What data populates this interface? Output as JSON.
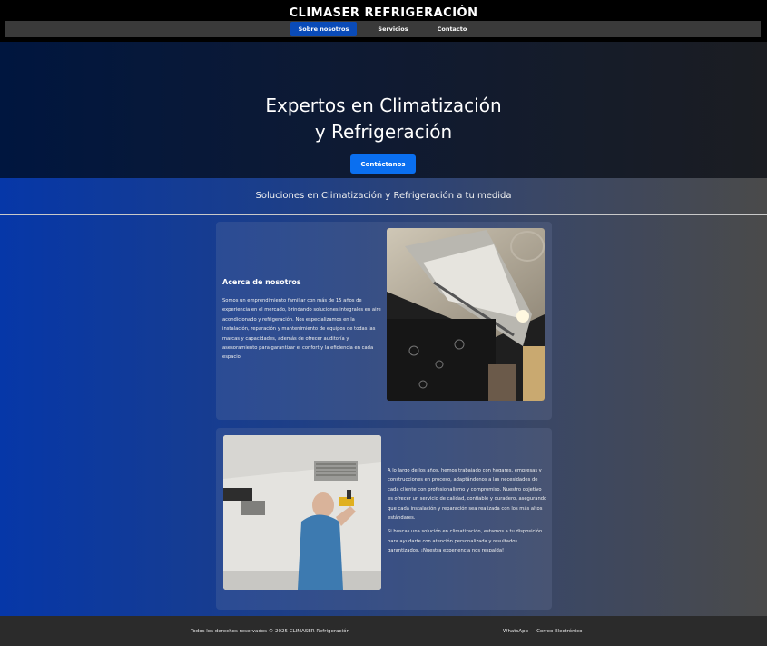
{
  "header": {
    "brand": "CLIMASER REFRIGERACIÓN",
    "nav": [
      {
        "label": "Sobre nosotros",
        "active": true
      },
      {
        "label": "Servicios",
        "active": false
      },
      {
        "label": "Contacto",
        "active": false
      }
    ]
  },
  "hero": {
    "title_line1": "Expertos en Climatización",
    "title_line2": "y Refrigeración",
    "cta_label": "Contáctanos"
  },
  "main": {
    "tagline": "Soluciones en Climatización y Refrigeración a tu medida",
    "about": {
      "title": "Acerca de nosotros",
      "text": "Somos un emprendimiento familiar con más de 15 años de experiencia en el mercado, brindando soluciones integrales en aire acondicionado y refrigeración. Nos especializamos en la instalación, reparación y mantenimiento de equipos de todas las marcas y capacidades, además de ofrecer auditoría y asesoramiento para garantizar el confort y la eficiencia en cada espacio."
    },
    "history": {
      "paragraph1": "A lo largo de los años, hemos trabajado con hogares, empresas y construcciones en proceso, adaptándonos a las necesidades de cada cliente con profesionalismo y compromiso. Nuestro objetivo es ofrecer un servicio de calidad, confiable y duradero, asegurando que cada instalación y reparación sea realizada con los más altos estándares.",
      "paragraph2": "Si buscas una solución en climatización, estamos a tu disposición para ayudarte con atención personalizada y resultados garantizados. ¡Nuestra experiencia nos respalda!"
    }
  },
  "footer": {
    "copyright": "Todos los derechos reservados © 2025 CLIMASER Refrigeración",
    "links": [
      "WhatsApp",
      "Correo Electrónico"
    ]
  },
  "colors": {
    "accent": "#0a6ff0",
    "nav_active": "#0a4bb8"
  }
}
